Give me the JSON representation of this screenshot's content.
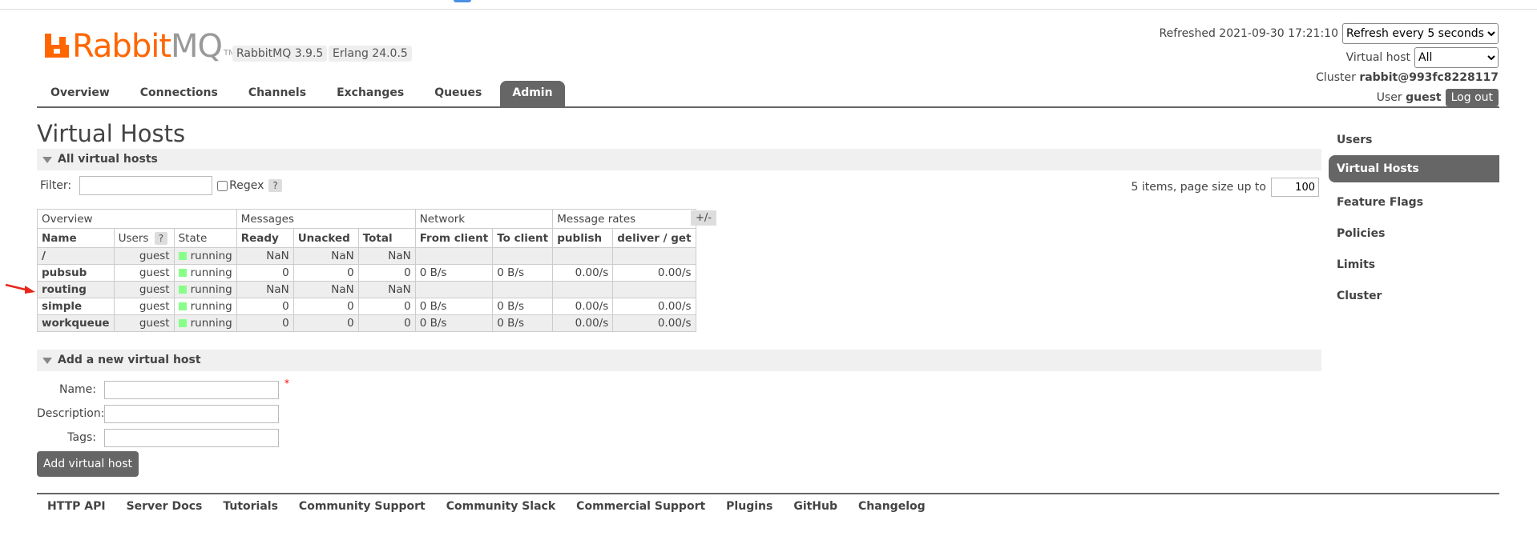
{
  "header": {
    "logo_rabbit": "Rabbit",
    "logo_mq": "MQ",
    "logo_tm": "TM",
    "rabbitmq_version": "RabbitMQ 3.9.5",
    "erlang_version": "Erlang 24.0.5",
    "refreshed_label": "Refreshed 2021-09-30 17:21:10",
    "refresh_select": "Refresh every 5 seconds",
    "vhost_label": "Virtual host",
    "vhost_select": "All",
    "cluster_label": "Cluster",
    "cluster_name": "rabbit@993fc8228117",
    "user_label": "User",
    "user_name": "guest",
    "logout_label": "Log out"
  },
  "nav": {
    "tabs": [
      {
        "label": "Overview"
      },
      {
        "label": "Connections"
      },
      {
        "label": "Channels"
      },
      {
        "label": "Exchanges"
      },
      {
        "label": "Queues"
      },
      {
        "label": "Admin"
      }
    ],
    "active": "Admin"
  },
  "page": {
    "title": "Virtual Hosts",
    "section_all": "All virtual hosts",
    "filter_label": "Filter:",
    "regex_label": "Regex",
    "help": "?",
    "paging_text": "5 items, page size up to",
    "page_size": "100",
    "plus_minus": "+/-"
  },
  "table": {
    "groups": [
      "Overview",
      "Messages",
      "Network",
      "Message rates"
    ],
    "headers": [
      "Name",
      "Users",
      "State",
      "Ready",
      "Unacked",
      "Total",
      "From client",
      "To client",
      "publish",
      "deliver / get"
    ],
    "rows": [
      {
        "name": "/",
        "users": "guest",
        "state": "running",
        "ready": "NaN",
        "unacked": "NaN",
        "total": "NaN",
        "from_client": "",
        "to_client": "",
        "publish": "",
        "deliver": ""
      },
      {
        "name": "pubsub",
        "users": "guest",
        "state": "running",
        "ready": "0",
        "unacked": "0",
        "total": "0",
        "from_client": "0 B/s",
        "to_client": "0 B/s",
        "publish": "0.00/s",
        "deliver": "0.00/s"
      },
      {
        "name": "routing",
        "users": "guest",
        "state": "running",
        "ready": "NaN",
        "unacked": "NaN",
        "total": "NaN",
        "from_client": "",
        "to_client": "",
        "publish": "",
        "deliver": ""
      },
      {
        "name": "simple",
        "users": "guest",
        "state": "running",
        "ready": "0",
        "unacked": "0",
        "total": "0",
        "from_client": "0 B/s",
        "to_client": "0 B/s",
        "publish": "0.00/s",
        "deliver": "0.00/s"
      },
      {
        "name": "workqueue",
        "users": "guest",
        "state": "running",
        "ready": "0",
        "unacked": "0",
        "total": "0",
        "from_client": "0 B/s",
        "to_client": "0 B/s",
        "publish": "0.00/s",
        "deliver": "0.00/s"
      }
    ],
    "state_color": "#88ff88"
  },
  "add_form": {
    "section": "Add a new virtual host",
    "name_label": "Name:",
    "description_label": "Description:",
    "tags_label": "Tags:",
    "required_mark": "*",
    "submit": "Add virtual host"
  },
  "sidebar": {
    "items": [
      {
        "label": "Users"
      },
      {
        "label": "Virtual Hosts"
      },
      {
        "label": "Feature Flags"
      },
      {
        "label": "Policies"
      },
      {
        "label": "Limits"
      },
      {
        "label": "Cluster"
      }
    ],
    "active": "Virtual Hosts"
  },
  "footer": {
    "links": [
      "HTTP API",
      "Server Docs",
      "Tutorials",
      "Community Support",
      "Community Slack",
      "Commercial Support",
      "Plugins",
      "GitHub",
      "Changelog"
    ]
  },
  "annotation": {
    "arrow_color": "#e8261a"
  }
}
